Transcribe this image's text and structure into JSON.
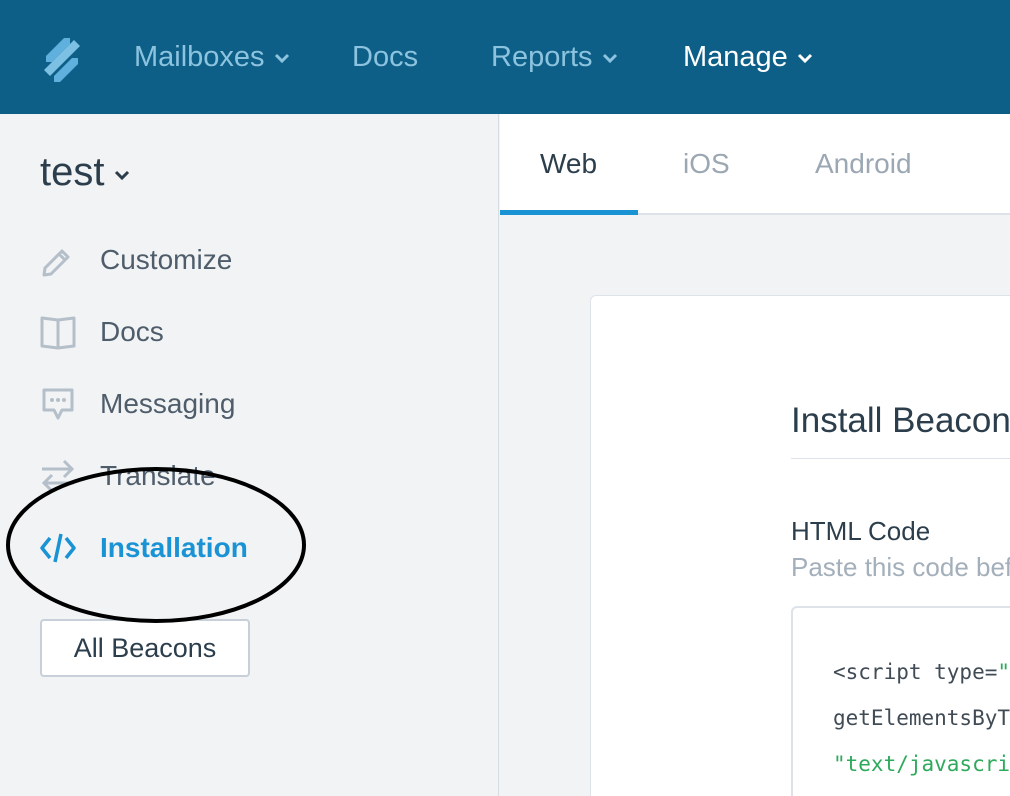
{
  "topnav": {
    "logo_icon": "helpscout-logo-icon",
    "items": [
      {
        "label": "Mailboxes",
        "has_dropdown": true,
        "active": false
      },
      {
        "label": "Docs",
        "has_dropdown": false,
        "active": false
      },
      {
        "label": "Reports",
        "has_dropdown": true,
        "active": false
      },
      {
        "label": "Manage",
        "has_dropdown": true,
        "active": true
      }
    ]
  },
  "sidebar": {
    "beacon_name": "test",
    "items": [
      {
        "label": "Customize",
        "icon": "pencil-icon",
        "active": false
      },
      {
        "label": "Docs",
        "icon": "book-icon",
        "active": false
      },
      {
        "label": "Messaging",
        "icon": "chat-bubble-icon",
        "active": false
      },
      {
        "label": "Translate",
        "icon": "arrows-swap-icon",
        "active": false
      },
      {
        "label": "Installation",
        "icon": "code-icon",
        "active": true
      }
    ],
    "all_beacons_label": "All Beacons"
  },
  "tabs": [
    {
      "label": "Web",
      "active": true
    },
    {
      "label": "iOS",
      "active": false
    },
    {
      "label": "Android",
      "active": false
    }
  ],
  "card": {
    "title": "Install Beacon",
    "html_code_label": "HTML Code",
    "html_code_sub": "Paste this code before",
    "code_lines": [
      {
        "plain": "<script type=",
        "string": "\"text/javascript\""
      },
      {
        "plain": "getElementsByTagName",
        "string": ""
      },
      {
        "plain": "",
        "string": "\"text/javascript\""
      }
    ]
  },
  "colors": {
    "topnav_bg": "#0d5f87",
    "nav_inactive": "#8cc3df",
    "accent": "#1a93d5",
    "code_string": "#2eaa5c"
  }
}
